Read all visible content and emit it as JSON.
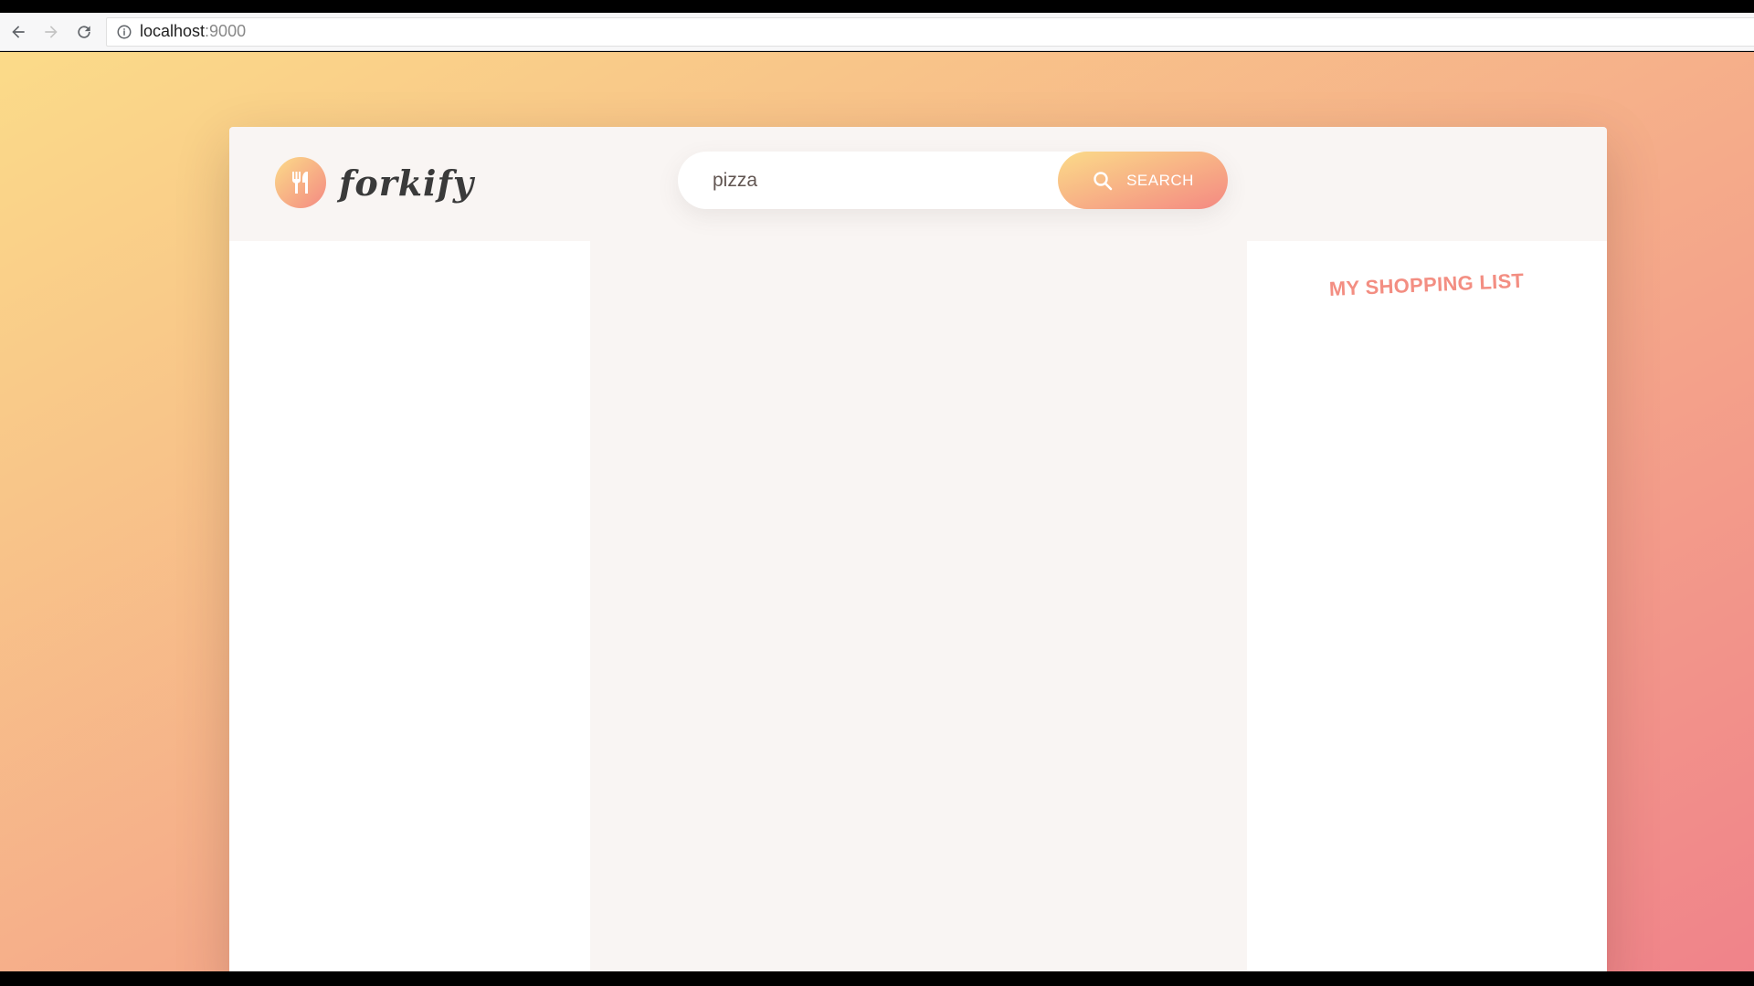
{
  "browser": {
    "url_host": "localhost",
    "url_port": ":9000"
  },
  "app": {
    "logo_text": "forkify"
  },
  "search": {
    "value": "pizza",
    "button_label": "SEARCH"
  },
  "shopping": {
    "title": "MY SHOPPING LIST"
  },
  "colors": {
    "gradient_start": "#fbdb89",
    "gradient_end": "#f48982",
    "accent_text": "#f38e82",
    "panel_bg": "#f9f5f3"
  }
}
